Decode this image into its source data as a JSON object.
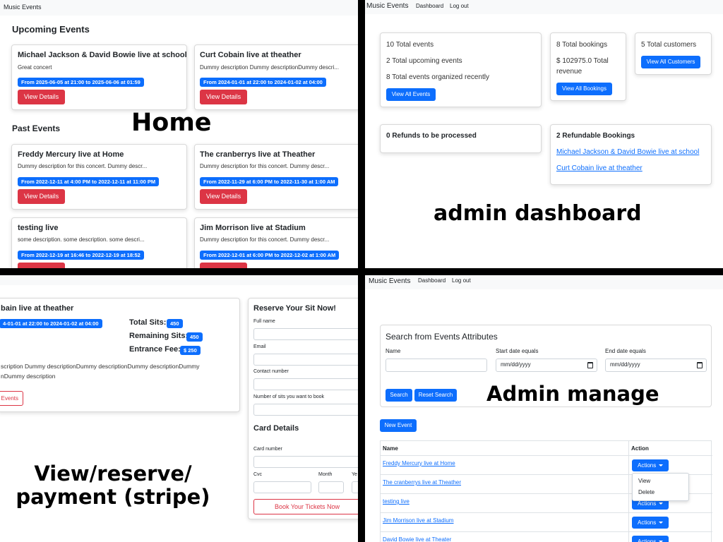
{
  "home": {
    "brand": "Music Events",
    "upcoming_title": "Upcoming Events",
    "past_title": "Past Events",
    "overlay_label": "Home",
    "upcoming": [
      {
        "title": "Michael Jackson & David Bowie live at school",
        "desc": "Great concert",
        "dates": "From 2025-06-05 at 21:00 to 2025-06-06 at 01:59",
        "button": "View Details"
      },
      {
        "title": "Curt Cobain live at theather",
        "desc": "Dummy description Dummy descriptionDummy descri...",
        "dates": "From 2024-01-01 at 22:00 to 2024-01-02 at 04:00",
        "button": "View Details"
      }
    ],
    "past": [
      {
        "title": "Freddy Mercury live at Home",
        "desc": "Dummy description for this concert. Dummy descr...",
        "dates": "From 2022-12-11 at 4:00 PM to 2022-12-11 at 11:00 PM",
        "button": "View Details"
      },
      {
        "title": "The cranberrys live at Theather",
        "desc": "Dummy description for this concert. Dummy descr...",
        "dates": "From 2022-11-29 at 6:00 PM to 2022-11-30 at 1:00 AM",
        "button": "View Details"
      },
      {
        "title": "testing live",
        "desc": "some description. some description. some descri...",
        "dates": "From 2022-12-19 at 16:46 to 2022-12-19 at 18:52",
        "button": ""
      },
      {
        "title": "Jim Morrison live at Stadium",
        "desc": "Dummy description for this concert. Dummy descr...",
        "dates": "From 2022-12-01 at 6:00 PM to 2022-12-02 at 1:00 AM",
        "button": ""
      }
    ]
  },
  "dashboard": {
    "brand": "Music Events",
    "nav": [
      "Dashboard",
      "Log out"
    ],
    "overlay_label": "admin dashboard",
    "events_card": {
      "lines": [
        "10 Total events",
        "2 Total upcoming events",
        "8 Total events organized recently"
      ],
      "button": "View All Events"
    },
    "bookings_card": {
      "lines": [
        "8 Total bookings",
        "$ 102975.0 Total",
        "revenue"
      ],
      "button": "View All Bookings"
    },
    "customers_card": {
      "lines": [
        "5 Total customers"
      ],
      "button": "View All Customers"
    },
    "refunds_card": {
      "title": "0 Refunds to be processed"
    },
    "refundable_card": {
      "title": "2 Refundable Bookings",
      "links": [
        "Michael Jackson & David Bowie live at school",
        "Curt Cobain live at theather"
      ]
    }
  },
  "view": {
    "overlay_label_1": "View/reserve/",
    "overlay_label_2": "payment (stripe)",
    "event_title": "bain live at theather",
    "event_dates": "4-01-01 at 22:00 to 2024-01-02 at 04:00",
    "total_sits_label": "Total Sits:",
    "total_sits": "450",
    "remaining_sits_label": "Remaining Sits:",
    "remaining_sits": "450",
    "entrance_fee_label": "Entrance Fee:",
    "entrance_fee": "$ 250",
    "desc_line1": "scription Dummy descriptionDummy descriptionDummy descriptionDummy",
    "desc_line2": "nDummy description",
    "events_button": "Events",
    "reserve_title": "Reserve Your Sit Now!",
    "fields": [
      "Full name",
      "Email",
      "Contact number",
      "Number of sits you want to book"
    ],
    "card_title": "Card Details",
    "card_number_label": "Card number",
    "cvc_label": "Cvc",
    "month_label": "Month",
    "year_label": "Ye",
    "book_button": "Book Your Tickets Now"
  },
  "manage": {
    "brand": "Music Events",
    "nav": [
      "Dashboard",
      "Log out"
    ],
    "overlay_label": "Admin manage",
    "search_title": "Search from Events Attributes",
    "name_label": "Name",
    "start_label": "Start date equals",
    "end_label": "End date equals",
    "start_placeholder": "mm/dd/yyyy",
    "end_placeholder": "mm/dd/yyyy",
    "search_button": "Search",
    "reset_button": "Reset Search",
    "new_event_button": "New Event",
    "col_name": "Name",
    "col_action": "Action",
    "rows": [
      "Freddy Mercury live at Home",
      "The cranberrys live at Theather",
      "testing live",
      "Jim Morrison live at Stadium",
      "David Bowie live at Theater"
    ],
    "actions_label": "Actions",
    "dropdown": [
      "View",
      "Delete"
    ]
  }
}
